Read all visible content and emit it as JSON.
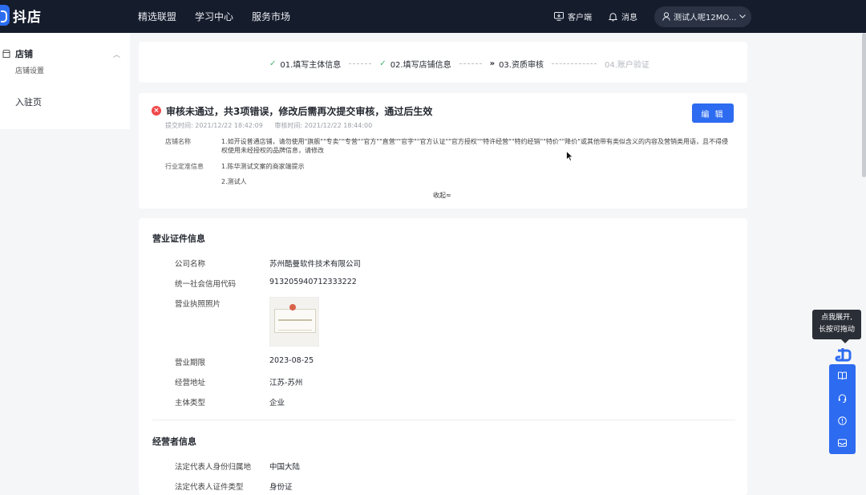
{
  "topbar": {
    "logo_text": "抖店",
    "nav": [
      "精选联盟",
      "学习中心",
      "服务市场"
    ],
    "client_label": "客户端",
    "message_label": "消息",
    "user_label": "测试人呢12MO..."
  },
  "sidebar": {
    "store_label": "店铺",
    "store_settings_label": "店铺设置",
    "entry_label": "入驻页"
  },
  "steps": [
    {
      "mark": "✓",
      "label": "01.填写主体信息",
      "state": "done"
    },
    {
      "mark": "✓",
      "label": "02.填写店铺信息",
      "state": "done"
    },
    {
      "mark": "»",
      "label": "03.资质审核",
      "state": "current"
    },
    {
      "mark": "",
      "label": "04.账户验证",
      "state": "pending"
    }
  ],
  "audit": {
    "title": "审核未通过，共3项错误，修改后需再次提交审核，通过后生效",
    "edit_label": "编 辑",
    "submit_time": "提交时间: 2021/12/22 18:42:09",
    "review_time": "审核时间: 2021/12/22 18:44:00",
    "store_name_label": "店铺名称",
    "store_name_error_line1": "1.如开设普通店铺，请勿使用\"旗舰\"\"专卖\"\"专营\"\"官方\"\"直营\"\"官字\"\"官方认证\"\"官方授权\"\"特许经营\"\"特约经销\"\"特价\"\"降价\"或其他带有类似含义的内容及营销类用语，且不得侵",
    "store_name_error_line2": "权使用未经授权的品牌信息，请修改",
    "industry_label": "行业定准信息",
    "industry_error_1": "1.陈华测试文案的商家端提示",
    "industry_error_2": "2.测试人",
    "collapse_label": "收起≈"
  },
  "license_section": {
    "title": "营业证件信息",
    "company_name_label": "公司名称",
    "company_name": "苏州酷曼软件技术有限公司",
    "credit_code_label": "统一社会信用代码",
    "credit_code": "913205940712333222",
    "license_photo_label": "营业执照照片",
    "validity_label": "营业期限",
    "validity": "2023-08-25",
    "address_label": "经营地址",
    "address": "江苏-苏州",
    "entity_type_label": "主体类型",
    "entity_type": "企业"
  },
  "operator_section": {
    "title": "经营者信息",
    "id_region_label": "法定代表人身份归属地",
    "id_region": "中国大陆",
    "id_type_label": "法定代表人证件类型",
    "id_type": "身份证"
  },
  "float_widget": {
    "tooltip_line1": "点我展开,",
    "tooltip_line2": "长按可拖动"
  },
  "colors": {
    "topbar_bg": "#151c2c",
    "primary": "#2d6bf0",
    "error": "#f0494b",
    "success": "#44b46b"
  }
}
